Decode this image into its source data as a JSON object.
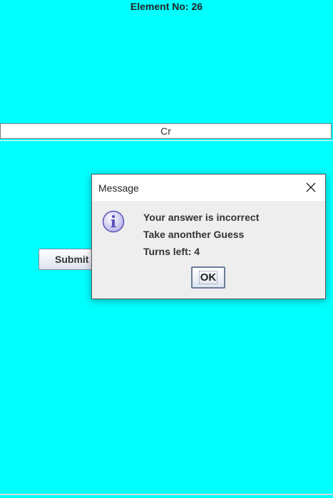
{
  "header": {
    "element_label": "Element No: 26"
  },
  "answer_field": {
    "value": "Cr"
  },
  "form": {
    "submit_label": "Submit"
  },
  "dialog": {
    "title": "Message",
    "icon": "info-icon",
    "lines": [
      "Your answer is incorrect",
      "Take anonther Guess",
      "Turns left: 4"
    ],
    "ok_label": "OK"
  },
  "colors": {
    "background": "#00ffff",
    "dialog_background": "#eeeeee",
    "titlebar": "#ffffff"
  }
}
